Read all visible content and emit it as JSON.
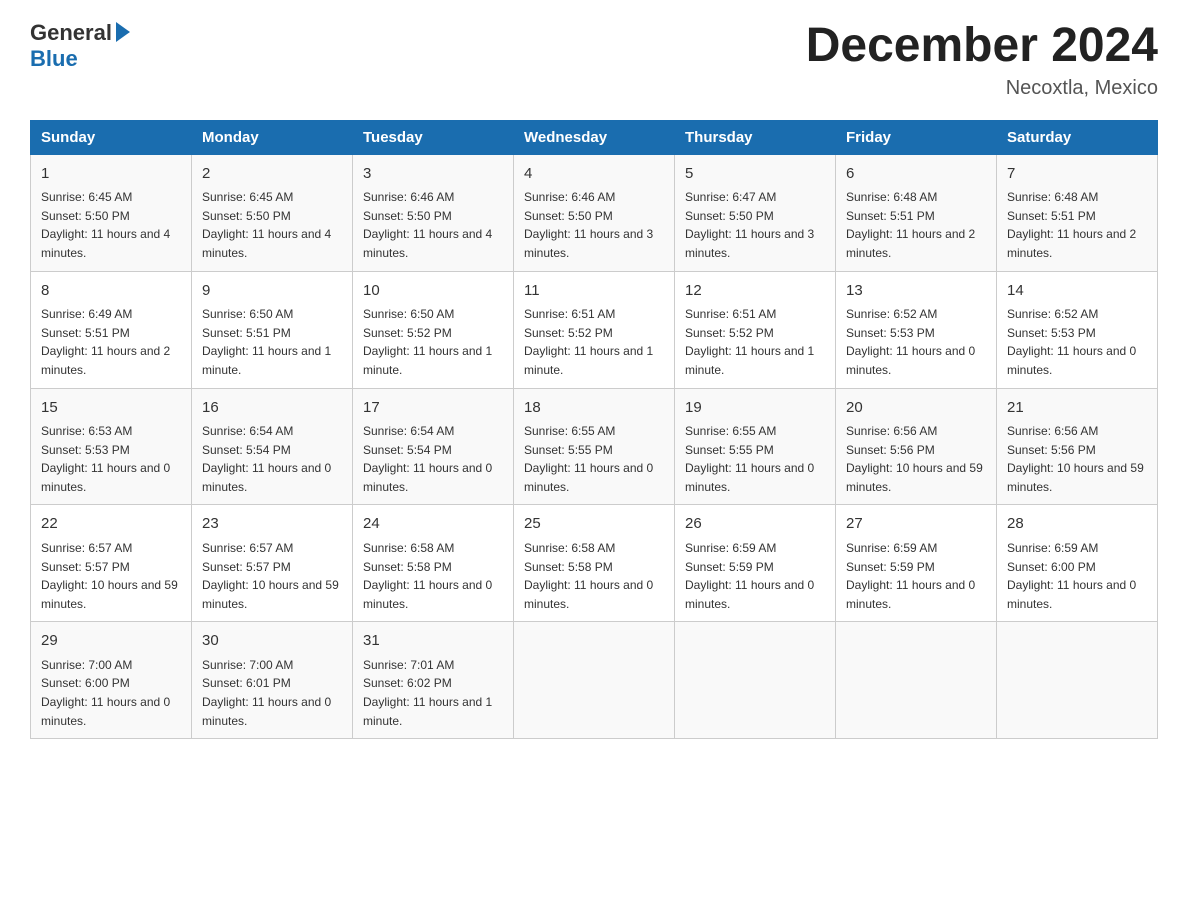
{
  "header": {
    "logo_general": "General",
    "logo_blue": "Blue",
    "month_title": "December 2024",
    "location": "Necoxtla, Mexico"
  },
  "days_of_week": [
    "Sunday",
    "Monday",
    "Tuesday",
    "Wednesday",
    "Thursday",
    "Friday",
    "Saturday"
  ],
  "weeks": [
    [
      {
        "day": "1",
        "sunrise": "6:45 AM",
        "sunset": "5:50 PM",
        "daylight": "11 hours and 4 minutes."
      },
      {
        "day": "2",
        "sunrise": "6:45 AM",
        "sunset": "5:50 PM",
        "daylight": "11 hours and 4 minutes."
      },
      {
        "day": "3",
        "sunrise": "6:46 AM",
        "sunset": "5:50 PM",
        "daylight": "11 hours and 4 minutes."
      },
      {
        "day": "4",
        "sunrise": "6:46 AM",
        "sunset": "5:50 PM",
        "daylight": "11 hours and 3 minutes."
      },
      {
        "day": "5",
        "sunrise": "6:47 AM",
        "sunset": "5:50 PM",
        "daylight": "11 hours and 3 minutes."
      },
      {
        "day": "6",
        "sunrise": "6:48 AM",
        "sunset": "5:51 PM",
        "daylight": "11 hours and 2 minutes."
      },
      {
        "day": "7",
        "sunrise": "6:48 AM",
        "sunset": "5:51 PM",
        "daylight": "11 hours and 2 minutes."
      }
    ],
    [
      {
        "day": "8",
        "sunrise": "6:49 AM",
        "sunset": "5:51 PM",
        "daylight": "11 hours and 2 minutes."
      },
      {
        "day": "9",
        "sunrise": "6:50 AM",
        "sunset": "5:51 PM",
        "daylight": "11 hours and 1 minute."
      },
      {
        "day": "10",
        "sunrise": "6:50 AM",
        "sunset": "5:52 PM",
        "daylight": "11 hours and 1 minute."
      },
      {
        "day": "11",
        "sunrise": "6:51 AM",
        "sunset": "5:52 PM",
        "daylight": "11 hours and 1 minute."
      },
      {
        "day": "12",
        "sunrise": "6:51 AM",
        "sunset": "5:52 PM",
        "daylight": "11 hours and 1 minute."
      },
      {
        "day": "13",
        "sunrise": "6:52 AM",
        "sunset": "5:53 PM",
        "daylight": "11 hours and 0 minutes."
      },
      {
        "day": "14",
        "sunrise": "6:52 AM",
        "sunset": "5:53 PM",
        "daylight": "11 hours and 0 minutes."
      }
    ],
    [
      {
        "day": "15",
        "sunrise": "6:53 AM",
        "sunset": "5:53 PM",
        "daylight": "11 hours and 0 minutes."
      },
      {
        "day": "16",
        "sunrise": "6:54 AM",
        "sunset": "5:54 PM",
        "daylight": "11 hours and 0 minutes."
      },
      {
        "day": "17",
        "sunrise": "6:54 AM",
        "sunset": "5:54 PM",
        "daylight": "11 hours and 0 minutes."
      },
      {
        "day": "18",
        "sunrise": "6:55 AM",
        "sunset": "5:55 PM",
        "daylight": "11 hours and 0 minutes."
      },
      {
        "day": "19",
        "sunrise": "6:55 AM",
        "sunset": "5:55 PM",
        "daylight": "11 hours and 0 minutes."
      },
      {
        "day": "20",
        "sunrise": "6:56 AM",
        "sunset": "5:56 PM",
        "daylight": "10 hours and 59 minutes."
      },
      {
        "day": "21",
        "sunrise": "6:56 AM",
        "sunset": "5:56 PM",
        "daylight": "10 hours and 59 minutes."
      }
    ],
    [
      {
        "day": "22",
        "sunrise": "6:57 AM",
        "sunset": "5:57 PM",
        "daylight": "10 hours and 59 minutes."
      },
      {
        "day": "23",
        "sunrise": "6:57 AM",
        "sunset": "5:57 PM",
        "daylight": "10 hours and 59 minutes."
      },
      {
        "day": "24",
        "sunrise": "6:58 AM",
        "sunset": "5:58 PM",
        "daylight": "11 hours and 0 minutes."
      },
      {
        "day": "25",
        "sunrise": "6:58 AM",
        "sunset": "5:58 PM",
        "daylight": "11 hours and 0 minutes."
      },
      {
        "day": "26",
        "sunrise": "6:59 AM",
        "sunset": "5:59 PM",
        "daylight": "11 hours and 0 minutes."
      },
      {
        "day": "27",
        "sunrise": "6:59 AM",
        "sunset": "5:59 PM",
        "daylight": "11 hours and 0 minutes."
      },
      {
        "day": "28",
        "sunrise": "6:59 AM",
        "sunset": "6:00 PM",
        "daylight": "11 hours and 0 minutes."
      }
    ],
    [
      {
        "day": "29",
        "sunrise": "7:00 AM",
        "sunset": "6:00 PM",
        "daylight": "11 hours and 0 minutes."
      },
      {
        "day": "30",
        "sunrise": "7:00 AM",
        "sunset": "6:01 PM",
        "daylight": "11 hours and 0 minutes."
      },
      {
        "day": "31",
        "sunrise": "7:01 AM",
        "sunset": "6:02 PM",
        "daylight": "11 hours and 1 minute."
      },
      null,
      null,
      null,
      null
    ]
  ]
}
